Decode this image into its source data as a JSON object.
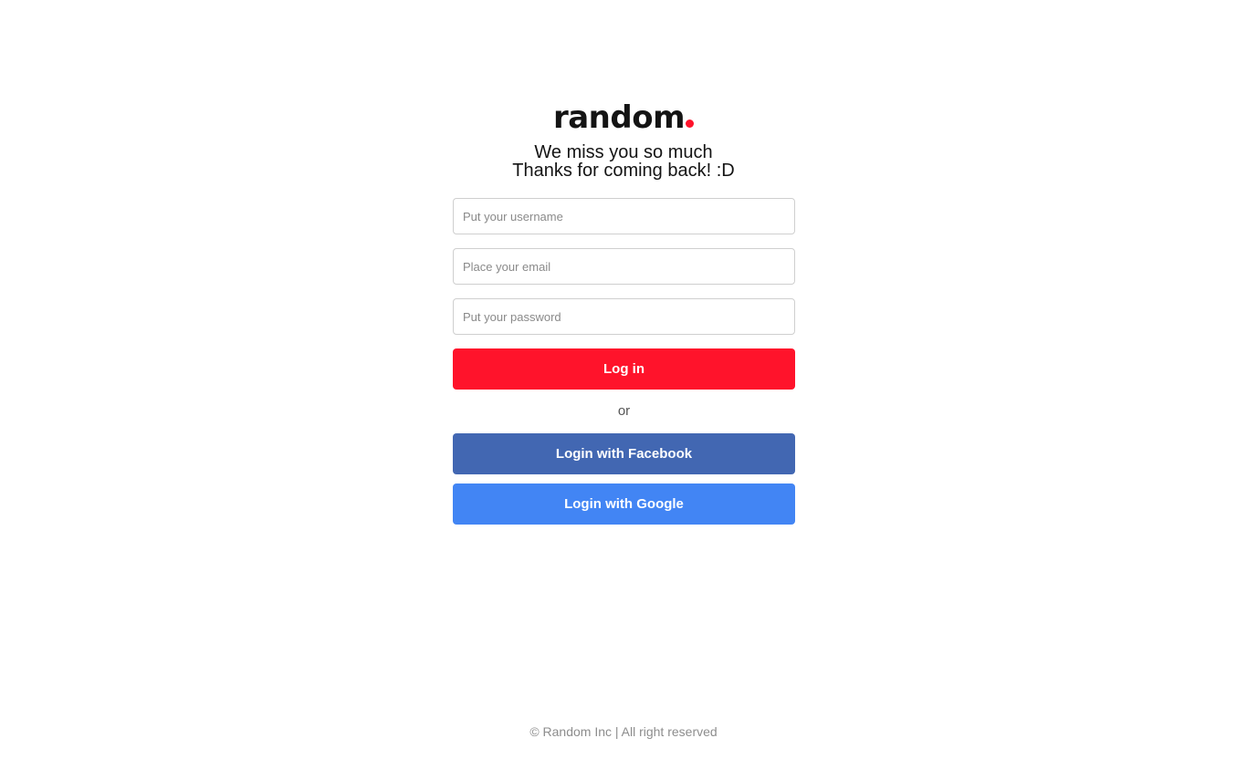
{
  "brand": {
    "name": "random",
    "accent_color": "#ff132b"
  },
  "greeting": {
    "line1": "We miss you so much",
    "line2": "Thanks for coming back! :D"
  },
  "form": {
    "username_placeholder": "Put your username",
    "email_placeholder": "Place your email",
    "password_placeholder": "Put your password",
    "login_label": "Log in",
    "separator": "or",
    "facebook_label": "Login with Facebook",
    "google_label": "Login with Google"
  },
  "colors": {
    "login_button": "#ff132b",
    "facebook_button": "#4267b2",
    "google_button": "#4285f4"
  },
  "footer": {
    "text": "© Random Inc | All right reserved"
  }
}
